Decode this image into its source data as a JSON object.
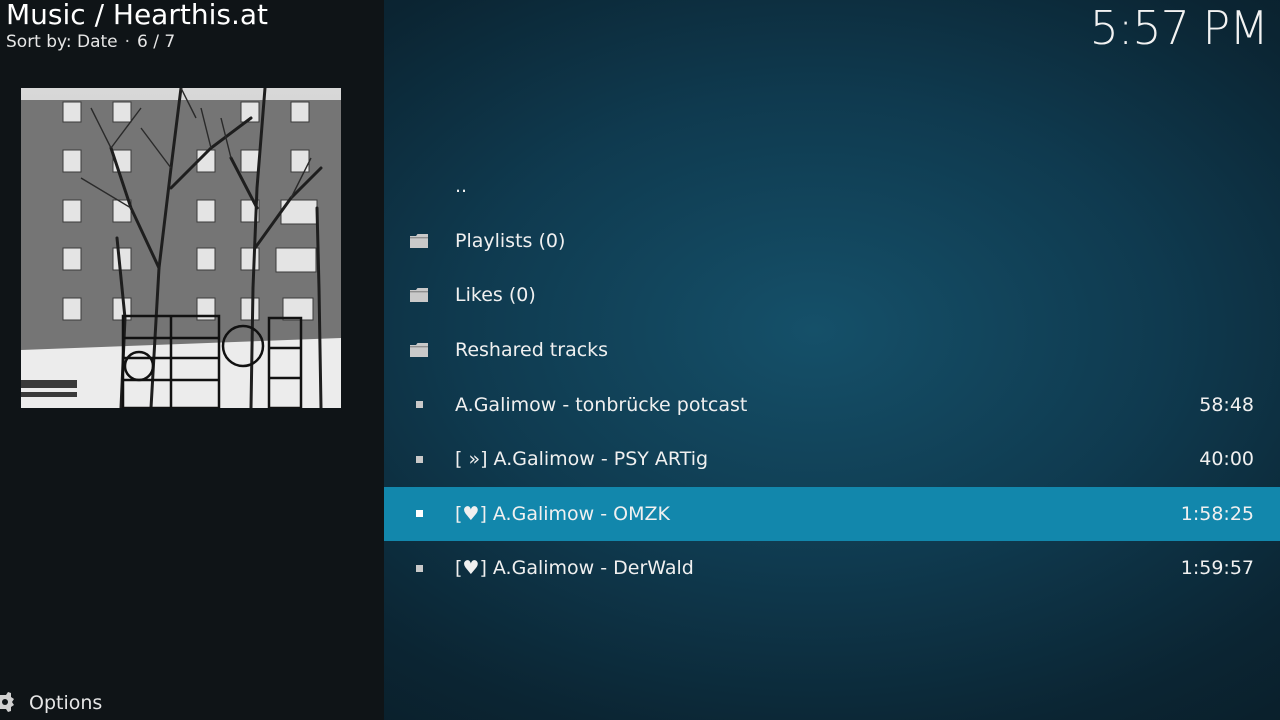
{
  "header": {
    "title": "Music / Hearthis.at",
    "sort_label": "Sort by: Date",
    "separator": "·",
    "position": "6 / 7"
  },
  "clock": "5:57 PM",
  "footer": {
    "options_label": "Options"
  },
  "list": {
    "items": [
      {
        "label": "..",
        "duration": "",
        "icon": "none"
      },
      {
        "label": "Playlists (0)",
        "duration": "",
        "icon": "folder-icon"
      },
      {
        "label": "Likes (0)",
        "duration": "",
        "icon": "folder-icon"
      },
      {
        "label": "Reshared tracks",
        "duration": "",
        "icon": "folder-icon"
      },
      {
        "label": "A.Galimow - tonbrücke potcast",
        "duration": "58:48",
        "icon": "track-icon"
      },
      {
        "label": "[ »] A.Galimow - PSY ARTig",
        "duration": "40:00",
        "icon": "track-icon"
      },
      {
        "label": "[♥] A.Galimow - OMZK",
        "duration": "1:58:25",
        "icon": "track-icon",
        "selected": true
      },
      {
        "label": "[♥] A.Galimow - DerWald",
        "duration": "1:59:57",
        "icon": "track-icon"
      }
    ]
  },
  "colors": {
    "selection": "#1287ac",
    "left_panel": "#0f1417",
    "background": "#0f3a4f"
  }
}
